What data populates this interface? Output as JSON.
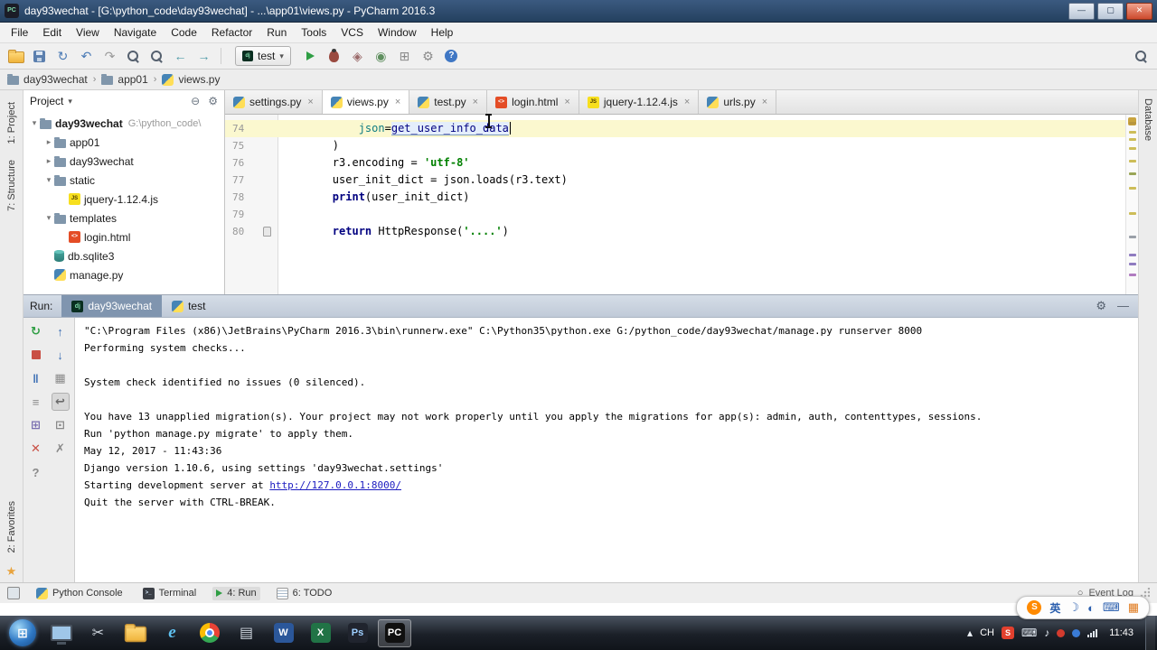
{
  "icons": {
    "chevron_down": "▾",
    "chevron_right": "▸",
    "gear": "⚙",
    "collapse_all": "⊖",
    "crumb_sep": "›",
    "star": "★",
    "event_log": "○",
    "start": "⊞"
  },
  "window": {
    "icon_label": "PC",
    "title": "day93wechat - [G:\\python_code\\day93wechat] - ...\\app01\\views.py - PyCharm 2016.3",
    "controls": [
      {
        "name": "minimize-button",
        "glyph": "—"
      },
      {
        "name": "maximize-button",
        "glyph": "▢"
      },
      {
        "name": "close-button",
        "glyph": "✕",
        "close": true
      }
    ]
  },
  "menubar": [
    "File",
    "Edit",
    "View",
    "Navigate",
    "Code",
    "Refactor",
    "Run",
    "Tools",
    "VCS",
    "Window",
    "Help"
  ],
  "toolbar": {
    "left_icons": [
      {
        "name": "open-icon",
        "type": "folder"
      },
      {
        "name": "save-all-icon",
        "type": "disk"
      },
      {
        "name": "synchronize-icon",
        "glyph": "↻",
        "color": "#4a7ab5"
      },
      {
        "name": "undo-icon",
        "glyph": "↶",
        "color": "#4a7ab5"
      },
      {
        "name": "redo-icon",
        "glyph": "↷",
        "color": "#9a9a9a"
      },
      {
        "name": "find-icon",
        "type": "search"
      },
      {
        "name": "replace-icon",
        "type": "search"
      },
      {
        "name": "back-icon",
        "glyph": "←",
        "color": "#4f9aa8"
      },
      {
        "name": "forward-icon",
        "glyph": "→",
        "color": "#4f9aa8"
      }
    ],
    "run_config": {
      "label": "test",
      "icon_bg": "#092e20",
      "icon_label": "dj"
    },
    "run_icons": [
      {
        "name": "run-icon",
        "type": "play"
      },
      {
        "name": "debug-icon",
        "type": "bug"
      },
      {
        "name": "coverage-icon",
        "glyph": "◈",
        "color": "#9a6a6a"
      },
      {
        "name": "profiler-icon",
        "glyph": "◉",
        "color": "#5f8f5f"
      },
      {
        "name": "restore-layout-icon",
        "glyph": "⊞",
        "color": "#8a8a8a"
      },
      {
        "name": "settings-icon",
        "glyph": "⚙",
        "color": "#8a8a8a"
      },
      {
        "name": "help-icon",
        "type": "help",
        "glyph": "?"
      }
    ]
  },
  "breadcrumbs": [
    {
      "icon": "folder",
      "label": "day93wechat"
    },
    {
      "icon": "folder",
      "label": "app01"
    },
    {
      "icon": "py",
      "label": "views.py"
    }
  ],
  "left_strip": {
    "top": [
      "1: Project",
      "7: Structure"
    ],
    "bottom": [
      "2: Favorites"
    ]
  },
  "right_strip": [
    "Database"
  ],
  "project": {
    "header": {
      "title": "Project"
    },
    "tree": [
      {
        "depth": 0,
        "arrow": "down",
        "icon": "folder",
        "label": "day93wechat",
        "bold": true,
        "extra": "G:\\python_code\\"
      },
      {
        "depth": 1,
        "arrow": "right",
        "icon": "folder",
        "label": "app01"
      },
      {
        "depth": 1,
        "arrow": "right",
        "icon": "folder",
        "label": "day93wechat"
      },
      {
        "depth": 1,
        "arrow": "down",
        "icon": "folder",
        "label": "static"
      },
      {
        "depth": 2,
        "arrow": "",
        "icon": "js",
        "label": "jquery-1.12.4.js"
      },
      {
        "depth": 1,
        "arrow": "down",
        "icon": "folder",
        "label": "templates"
      },
      {
        "depth": 2,
        "arrow": "",
        "icon": "html",
        "label": "login.html"
      },
      {
        "depth": 1,
        "arrow": "",
        "icon": "db",
        "label": "db.sqlite3"
      },
      {
        "depth": 1,
        "arrow": "",
        "icon": "py",
        "label": "manage.py"
      }
    ]
  },
  "editor": {
    "tabs": [
      {
        "icon": "py",
        "label": "settings.py",
        "close": "×"
      },
      {
        "icon": "py",
        "label": "views.py",
        "close": "×",
        "active": true
      },
      {
        "icon": "py",
        "label": "test.py",
        "close": "×"
      },
      {
        "icon": "html",
        "label": "login.html",
        "close": "×"
      },
      {
        "icon": "js",
        "label": "jquery-1.12.4.js",
        "close": "×"
      },
      {
        "icon": "py",
        "label": "urls.py",
        "close": "×"
      }
    ],
    "lines": [
      {
        "num": "74",
        "hl": true,
        "caret": true,
        "tok": [
          [
            "pl",
            "            "
          ],
          [
            "param",
            "json"
          ],
          [
            "pl",
            "="
          ],
          [
            "usage",
            "get_user_info_data"
          ]
        ]
      },
      {
        "num": "75",
        "tok": [
          [
            "pl",
            "        )"
          ]
        ]
      },
      {
        "num": "76",
        "tok": [
          [
            "pl",
            "        r3.encoding = "
          ],
          [
            "str",
            "'utf-8'"
          ]
        ]
      },
      {
        "num": "77",
        "tok": [
          [
            "pl",
            "        user_init_dict = json.loads(r3.text)"
          ]
        ]
      },
      {
        "num": "78",
        "tok": [
          [
            "pl",
            "        "
          ],
          [
            "kw",
            "print"
          ],
          [
            "pl",
            "(user_init_dict)"
          ]
        ]
      },
      {
        "num": "79",
        "tok": []
      },
      {
        "num": "80",
        "marker": true,
        "tok": [
          [
            "pl",
            "        "
          ],
          [
            "kw",
            "return"
          ],
          [
            "pl",
            " HttpResponse("
          ],
          [
            "str",
            "'....'"
          ],
          [
            "pl",
            ")"
          ]
        ]
      }
    ],
    "stripe_marks": [
      {
        "t": 8,
        "c": "#b8963f"
      },
      {
        "t": 18,
        "c": "#cdbd58"
      },
      {
        "t": 26,
        "c": "#cdbd58"
      },
      {
        "t": 36,
        "c": "#cdbd58"
      },
      {
        "t": 50,
        "c": "#cdbd58"
      },
      {
        "t": 64,
        "c": "#9aa657"
      },
      {
        "t": 80,
        "c": "#cdbd58"
      },
      {
        "t": 108,
        "c": "#cdbd58"
      },
      {
        "t": 134,
        "c": "#9aa0a8"
      },
      {
        "t": 154,
        "c": "#8f7bc0"
      },
      {
        "t": 164,
        "c": "#8f7bc0"
      },
      {
        "t": 176,
        "c": "#b07bc0"
      }
    ]
  },
  "run_panel": {
    "label": "Run:",
    "tabs": [
      {
        "icon": "django",
        "label": "day93wechat",
        "active": true
      },
      {
        "icon": "py",
        "label": "test"
      }
    ],
    "header_icons": [
      {
        "name": "settings-icon",
        "glyph": "⚙"
      },
      {
        "name": "hide-icon",
        "glyph": "—"
      }
    ],
    "tools_a": [
      {
        "name": "rerun-icon",
        "glyph": "↻",
        "color": "#2f9e44"
      },
      {
        "name": "stop-icon",
        "type": "stop"
      },
      {
        "name": "pause-icon",
        "glyph": "‖",
        "color": "#3d6fb4"
      },
      {
        "name": "frames-icon",
        "glyph": "≡",
        "color": "#8a8a8a"
      },
      {
        "name": "restore-layout-icon",
        "glyph": "⊞",
        "color": "#7a6fb0"
      },
      {
        "name": "close-icon",
        "glyph": "✕",
        "color": "#c94f44"
      },
      {
        "name": "help-icon",
        "glyph": "?",
        "color": "#8a8a8a"
      }
    ],
    "tools_b": [
      {
        "name": "up-the-stack-icon",
        "glyph": "↑",
        "color": "#3d6fb4"
      },
      {
        "name": "down-the-stack-icon",
        "glyph": "↓",
        "color": "#3d6fb4"
      },
      {
        "name": "console-settings-icon",
        "glyph": "▦",
        "color": "#8a8a8a"
      },
      {
        "name": "soft-wrap-icon",
        "glyph": "↩",
        "color": "#6a6a6a",
        "pressed": true
      },
      {
        "name": "print-icon",
        "glyph": "⊡",
        "color": "#8a8a8a"
      },
      {
        "name": "clear-all-icon",
        "glyph": "✗",
        "color": "#8a8a8a"
      }
    ],
    "console": [
      [
        [
          "pl",
          "\"C:\\Program Files (x86)\\JetBrains\\PyCharm 2016.3\\bin\\runnerw.exe\" C:\\Python35\\python.exe G:/python_code/day93wechat/manage.py runserver 8000"
        ]
      ],
      [
        [
          "pl",
          "Performing system checks..."
        ]
      ],
      [],
      [
        [
          "pl",
          "System check identified no issues (0 silenced)."
        ]
      ],
      [],
      [
        [
          "pl",
          "You have 13 unapplied migration(s). Your project may not work properly until you apply the migrations for app(s): admin, auth, contenttypes, sessions."
        ]
      ],
      [
        [
          "pl",
          "Run 'python manage.py migrate' to apply them."
        ]
      ],
      [
        [
          "pl",
          "May 12, 2017 - 11:43:36"
        ]
      ],
      [
        [
          "pl",
          "Django version 1.10.6, using settings 'day93wechat.settings'"
        ]
      ],
      [
        [
          "pl",
          "Starting development server at "
        ],
        [
          "link",
          "http://127.0.0.1:8000/"
        ]
      ],
      [
        [
          "pl",
          "Quit the server with CTRL-BREAK."
        ]
      ]
    ]
  },
  "status_bar": {
    "items": [
      {
        "icon": "py",
        "label": "Python Console"
      },
      {
        "icon": "terminal",
        "label": "Terminal"
      },
      {
        "icon": "run",
        "label": "4: Run",
        "active": true
      },
      {
        "icon": "todo",
        "label": "6: TODO"
      }
    ],
    "event_log": "Event Log"
  },
  "ime_bar": {
    "items": [
      {
        "name": "sogou-logo-icon",
        "badge": "S",
        "bg": "#ff8a00"
      },
      {
        "name": "lang-mode-indicator",
        "text": "英",
        "color": "#2b5fae"
      },
      {
        "name": "moon-icon",
        "glyph": "☽",
        "color": "#2b5fae"
      },
      {
        "name": "fullwidth-icon",
        "glyph": "◐",
        "color": "#2b5fae"
      },
      {
        "name": "keyboard-icon",
        "glyph": "⌨",
        "color": "#2b5fae"
      },
      {
        "name": "toolbox-icon",
        "glyph": "▦",
        "color": "#e07b20"
      }
    ]
  },
  "taskbar": {
    "items": [
      {
        "name": "remote-desktop-icon",
        "type": "monitor"
      },
      {
        "name": "snipping-tool-icon",
        "glyph": "✂",
        "color": "#cfd6de"
      },
      {
        "name": "explorer-icon",
        "type": "folder"
      },
      {
        "name": "ie-icon",
        "glyph": "e",
        "color": "#5ec1f0",
        "em": true
      },
      {
        "name": "chrome-icon",
        "type": "chrome"
      },
      {
        "name": "notepad-icon",
        "glyph": "▤",
        "color": "#cfd6de"
      },
      {
        "name": "word-icon",
        "badge": "W",
        "bg": "#2b579a",
        "fg": "#ffffff"
      },
      {
        "name": "excel-icon",
        "badge": "X",
        "bg": "#217346",
        "fg": "#ffffff"
      },
      {
        "name": "photoshop-icon",
        "badge": "Ps",
        "bg": "#20242e",
        "fg": "#9ecfff"
      },
      {
        "name": "pycharm-icon",
        "badge": "PC",
        "bg": "#101010",
        "fg": "#ffffff",
        "active": true
      }
    ],
    "tray": {
      "hidden_icons": "▴",
      "lang": "CH",
      "icons": [
        {
          "name": "sogou-tray-icon",
          "badge": "S",
          "bg": "#e2402e",
          "fg": "#ffffff"
        },
        {
          "name": "ime-keyboard-icon",
          "glyph": "⌨",
          "color": "#e6edf5"
        },
        {
          "name": "volume-icon",
          "glyph": "♪",
          "color": "#e6edf5"
        },
        {
          "name": "security-tray-icon",
          "dot": "#d23b2e"
        },
        {
          "name": "app-tray-icon",
          "dot": "#3a7bd5"
        },
        {
          "name": "network-icon",
          "type": "network"
        }
      ],
      "time": "11:43"
    }
  },
  "colors": {
    "kw": "#000080",
    "str": "#008000",
    "param": "#0f7c82",
    "link": "#1b1bc0",
    "line-hl": "#fbf8cf",
    "usage-bg": "#e4eefb",
    "gutter-num": "#999999",
    "run-tab-active": "#8095af"
  }
}
